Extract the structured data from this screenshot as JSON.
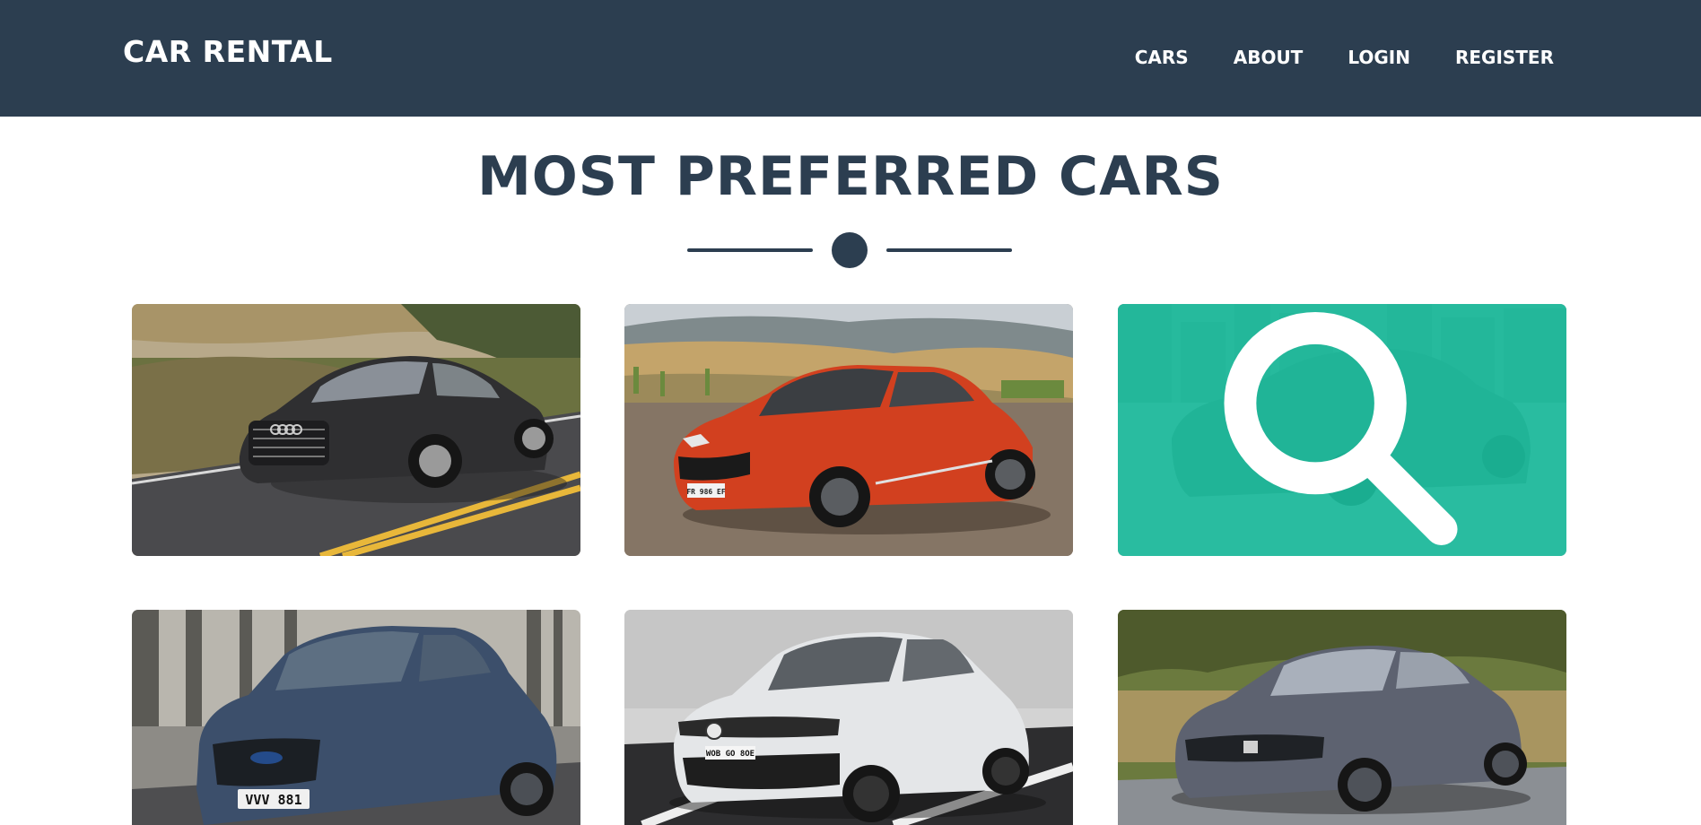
{
  "navbar": {
    "brand": "CAR RENTAL",
    "links": [
      {
        "label": "CARS"
      },
      {
        "label": "ABOUT"
      },
      {
        "label": "LOGIN"
      },
      {
        "label": "REGISTER"
      }
    ]
  },
  "main": {
    "title": "MOST PREFERRED CARS",
    "cars": [
      {
        "name": "audi-sedan",
        "color": "#2f2f31",
        "scene": "road-hills",
        "hovered": false
      },
      {
        "name": "renault-hatchback",
        "color": "#d2401f",
        "scene": "gravel-hills",
        "hovered": false,
        "plate": "FR 986 EF"
      },
      {
        "name": "fiat-sedan",
        "color": "#5f6468",
        "scene": "city",
        "hovered": true,
        "overlay_color": "#1abc9c"
      },
      {
        "name": "ford-hatchback",
        "color": "#3c4f6b",
        "scene": "building",
        "hovered": false,
        "plate": "VVV 881"
      },
      {
        "name": "vw-hatchback",
        "color": "#e4e6e8",
        "scene": "garage",
        "hovered": false,
        "plate": "WOB GO 8OE"
      },
      {
        "name": "honda-sedan",
        "color": "#5d6270",
        "scene": "grass",
        "hovered": false
      }
    ]
  },
  "colors": {
    "navbar_bg": "#2c3e50",
    "accent": "#1abc9c",
    "text_dark": "#2c3e50"
  }
}
